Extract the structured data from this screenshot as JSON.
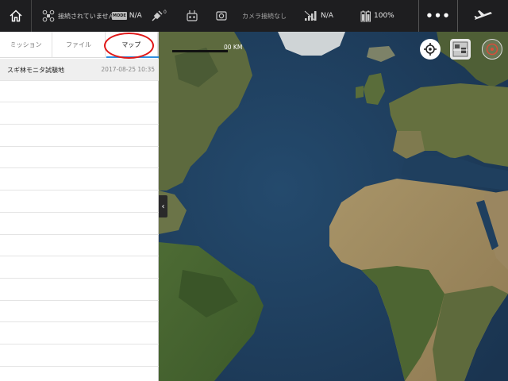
{
  "status_bar": {
    "connection": "接続されていません",
    "mode_chip": "MODE",
    "mode_value": "N/A",
    "satellites": "0",
    "camera": "カメラ接続なし",
    "signal": "N/A",
    "battery": "100%",
    "more": "•••"
  },
  "tabs": [
    {
      "label": "ミッション",
      "active": false
    },
    {
      "label": "ファイル",
      "active": false
    },
    {
      "label": "マップ",
      "active": true
    }
  ],
  "missions": [
    {
      "name": "スギ林モニタ試験地",
      "date": "2017-08-25 10:35"
    }
  ],
  "map": {
    "scale_label": "00 KM",
    "ocean_color": "#1f3d5c",
    "land_color": "#6f7b45"
  }
}
